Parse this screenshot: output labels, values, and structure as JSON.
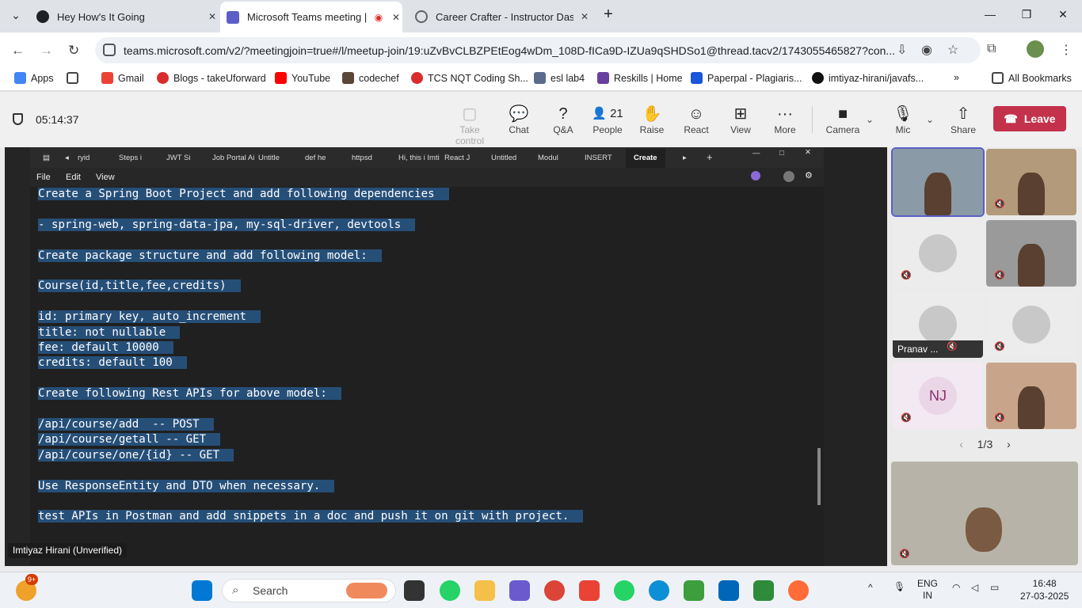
{
  "browser": {
    "tabs": [
      {
        "title": "Hey How's It Going",
        "color": "#202124"
      },
      {
        "title": "Microsoft Teams meeting | M",
        "color": "#5b5fc7"
      },
      {
        "title": "Career Crafter - Instructor Dash",
        "color": "#6b6b6b"
      }
    ],
    "new_tab": "+",
    "url": "teams.microsoft.com/v2/?meetingjoin=true#/l/meetup-join/19:uZvBvCLBZPEtEog4wDm_108D-fICa9D-IZUa9qSHDSo1@thread.tacv2/1743055465827?con...",
    "bookmarks": [
      "Apps",
      "Gmail",
      "Blogs - takeUforward",
      "YouTube",
      "codechef",
      "TCS NQT Coding Sh...",
      "esl lab4",
      "Reskills | Home",
      "Paperpal - Plagiaris...",
      "imtiyaz-hirani/javafs..."
    ],
    "all_bookmarks": "All Bookmarks"
  },
  "meeting": {
    "timer": "05:14:37",
    "toolbar": [
      {
        "label": "Take control",
        "icon": "take-control-icon",
        "glyph": "▢",
        "disabled": true
      },
      {
        "label": "Chat",
        "icon": "chat-icon",
        "glyph": "💬",
        "disabled": false
      },
      {
        "label": "Q&A",
        "icon": "qa-icon",
        "glyph": "?",
        "disabled": false
      },
      {
        "label": "People",
        "icon": "people-icon",
        "glyph": "👤 21",
        "disabled": false
      },
      {
        "label": "Raise",
        "icon": "hand-icon",
        "glyph": "✋",
        "disabled": false
      },
      {
        "label": "React",
        "icon": "react-icon",
        "glyph": "☺",
        "disabled": false
      },
      {
        "label": "View",
        "icon": "view-icon",
        "glyph": "⊞",
        "disabled": false
      },
      {
        "label": "More",
        "icon": "more-icon",
        "glyph": "···",
        "disabled": false
      },
      {
        "label": "Camera",
        "icon": "camera-icon",
        "glyph": "■",
        "disabled": false
      },
      {
        "label": "Mic",
        "icon": "mic-off-icon",
        "glyph": "🎙",
        "disabled": false
      },
      {
        "label": "Share",
        "icon": "share-icon",
        "glyph": "⇧",
        "disabled": false
      }
    ],
    "leave_label": "Leave",
    "presenter": "Imtiyaz Hirani (Unverified)",
    "pager": "1/3",
    "participants": [
      {
        "kind": "video",
        "color": "#8a9aa6"
      },
      {
        "kind": "video",
        "color": "#b39a7a"
      },
      {
        "kind": "avatar",
        "initials": "",
        "color": "#ececec"
      },
      {
        "kind": "video",
        "color": "#9a9a9a"
      },
      {
        "kind": "avatar",
        "initials": "",
        "name": "Pranav ...",
        "color": "#ececec"
      },
      {
        "kind": "avatar",
        "initials": "",
        "color": "#ececec"
      },
      {
        "kind": "avatar",
        "initials": "NJ",
        "color": "#f3e9f2"
      },
      {
        "kind": "video",
        "color": "#c8a58a"
      }
    ]
  },
  "notepad": {
    "tabs": [
      "ryid",
      "Steps i",
      "JWT Si",
      "Job Portal Ai",
      "Untitle",
      "def he",
      "httpsd",
      "Hi, this i Imti",
      "React J",
      "Untitled",
      "Modul",
      "INSERT",
      "Create"
    ],
    "menu": [
      "File",
      "Edit",
      "View"
    ],
    "lines": [
      "Create a Spring Boot Project and add following dependencies",
      "",
      "- spring-web, spring-data-jpa, my-sql-driver, devtools",
      "",
      "Create package structure and add following model:",
      "",
      "Course(id,title,fee,credits)",
      "",
      "id: primary key, auto_increment",
      "title: not nullable",
      "fee: default 10000",
      "credits: default 100",
      "",
      "Create following Rest APIs for above model:",
      "",
      "/api/course/add  -- POST",
      "/api/course/getall -- GET",
      "/api/course/one/{id} -- GET",
      "",
      "Use ResponseEntity and DTO when necessary.",
      "",
      "test APIs in Postman and add snippets in a doc and push it on git with project."
    ]
  },
  "taskbar": {
    "search": "Search",
    "notif_badge": "9+",
    "lang1": "ENG",
    "lang2": "IN",
    "time": "16:48",
    "date": "27-03-2025"
  }
}
